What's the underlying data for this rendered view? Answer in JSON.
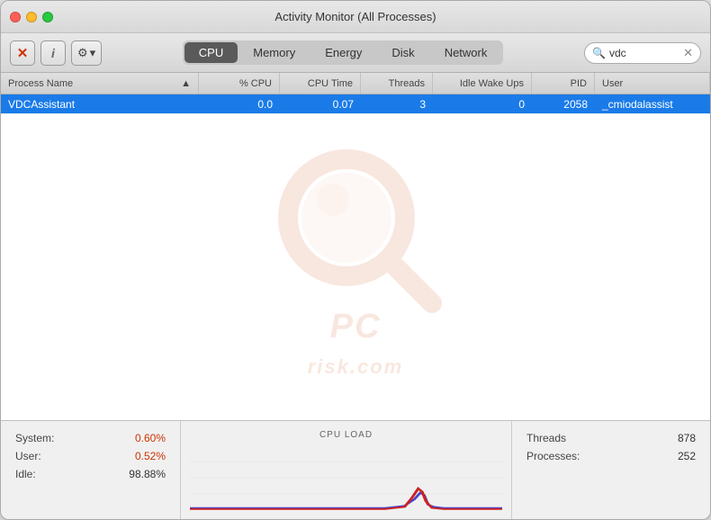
{
  "window": {
    "title": "Activity Monitor (All Processes)"
  },
  "titlebar": {
    "title": "Activity Monitor (All Processes)"
  },
  "toolbar": {
    "close_label": "✕",
    "info_label": "i",
    "gear_label": "⚙",
    "chevron_label": "▾"
  },
  "tabs": [
    {
      "id": "cpu",
      "label": "CPU",
      "active": true
    },
    {
      "id": "memory",
      "label": "Memory",
      "active": false
    },
    {
      "id": "energy",
      "label": "Energy",
      "active": false
    },
    {
      "id": "disk",
      "label": "Disk",
      "active": false
    },
    {
      "id": "network",
      "label": "Network",
      "active": false
    }
  ],
  "search": {
    "placeholder": "Search",
    "value": "vdc"
  },
  "columns": [
    {
      "id": "process-name",
      "label": "Process Name",
      "sort_icon": "▲"
    },
    {
      "id": "cpu-pct",
      "label": "% CPU"
    },
    {
      "id": "cpu-time",
      "label": "CPU Time"
    },
    {
      "id": "threads",
      "label": "Threads"
    },
    {
      "id": "idle-wake",
      "label": "Idle Wake Ups"
    },
    {
      "id": "pid",
      "label": "PID"
    },
    {
      "id": "user",
      "label": "User"
    }
  ],
  "rows": [
    {
      "process": "VDCAssistant",
      "cpu_pct": "0.0",
      "cpu_time": "0.07",
      "threads": "3",
      "idle_wake": "0",
      "pid": "2058",
      "user": "_cmiodalassist",
      "selected": true
    }
  ],
  "bottom": {
    "cpu_load_title": "CPU LOAD",
    "stats": [
      {
        "label": "System:",
        "value": "0.60%",
        "colored": true
      },
      {
        "label": "User:",
        "value": "0.52%",
        "colored": true
      },
      {
        "label": "Idle:",
        "value": "98.88%",
        "colored": false
      }
    ],
    "right_stats": [
      {
        "label": "Threads",
        "value": "878"
      },
      {
        "label": "Processes:",
        "value": "252"
      }
    ]
  },
  "watermark": {
    "text": "risk.com"
  }
}
